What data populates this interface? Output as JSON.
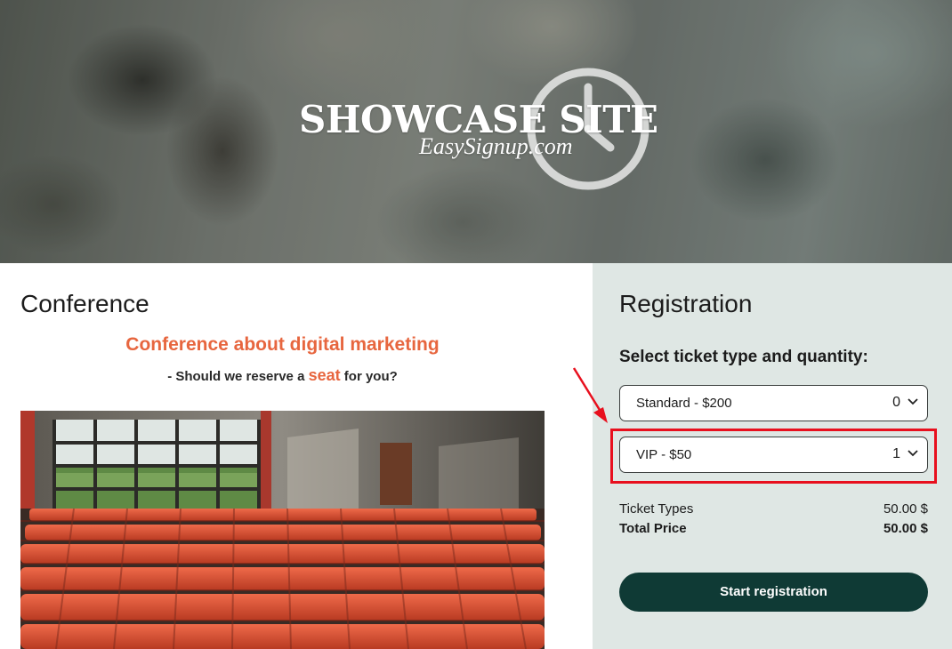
{
  "hero": {
    "logo_title": "SHOWCASE SITE",
    "logo_subtitle": "EasySignup.com",
    "logo_icon": "clock-icon"
  },
  "event": {
    "title": "Conference",
    "tagline": "Conference about digital marketing",
    "subline_before": "- Should we reserve a ",
    "subline_highlight": "seat",
    "subline_after": " for you?",
    "image": "red-theater-seats-photo"
  },
  "registration": {
    "title": "Registration",
    "ticket_heading": "Select ticket type and quantity:",
    "tickets": [
      {
        "label": "Standard - $200",
        "quantity": "0"
      },
      {
        "label": "VIP - $50",
        "quantity": "1"
      }
    ],
    "summary": {
      "ticket_types_label": "Ticket Types",
      "ticket_types_value": "50.00 $",
      "total_label": "Total Price",
      "total_value": "50.00 $"
    },
    "start_button": "Start registration"
  },
  "colors": {
    "accent": "#e7663f",
    "button": "#0f3a35",
    "panel": "#dfe7e4",
    "annotation": "#e8101e"
  }
}
